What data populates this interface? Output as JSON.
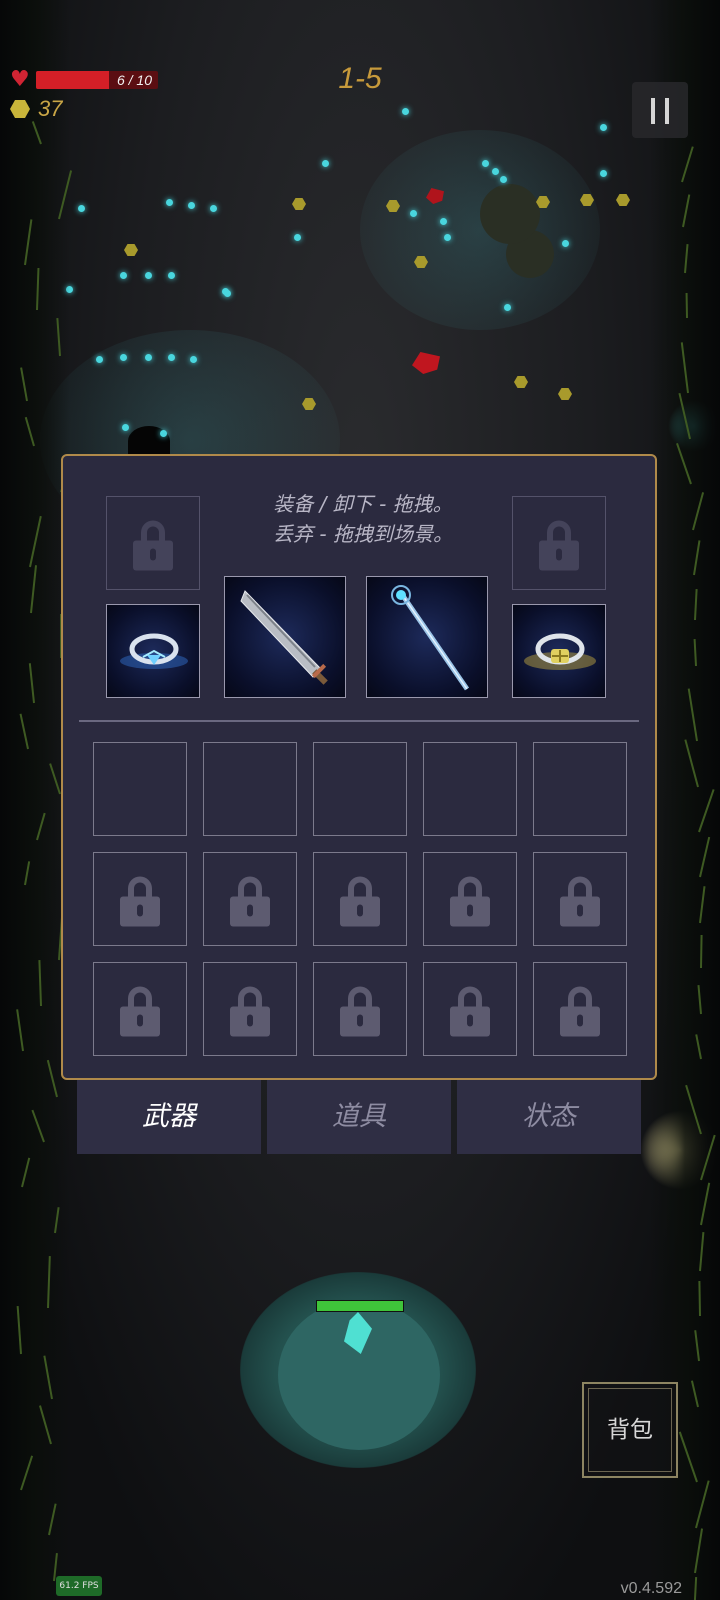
{
  "hud": {
    "hp_text": "6 / 10",
    "hp_fraction": 0.6,
    "gold": "37",
    "level": "1-5",
    "pause_icon": "pause-icon"
  },
  "inventory": {
    "instruction_line1": "装备 / 卸下 - 拖拽。",
    "instruction_line2": "丢弃 - 拖拽到场景。",
    "equipped": [
      {
        "name": "ring-blue-gem",
        "icon": "ring-icon"
      },
      {
        "name": "greatsword",
        "icon": "sword-icon"
      },
      {
        "name": "crystal-staff",
        "icon": "staff-icon"
      },
      {
        "name": "ring-gold-gem",
        "icon": "ring-icon"
      }
    ],
    "grid": {
      "rows": 3,
      "cols": 5,
      "unlocked_slots": 5
    }
  },
  "tabs": [
    {
      "label": "武器",
      "active": true
    },
    {
      "label": "道具",
      "active": false
    },
    {
      "label": "状态",
      "active": false
    }
  ],
  "bottom": {
    "backpack_label": "背包",
    "fps_text": "61.2 FPS",
    "version": "v0.4.592",
    "player_hp_fraction": 1.0
  },
  "colors": {
    "panel_bg": "#2b2a3f",
    "panel_border": "#b08a4a",
    "hp_red": "#d41f27",
    "gold": "#c9a646"
  }
}
